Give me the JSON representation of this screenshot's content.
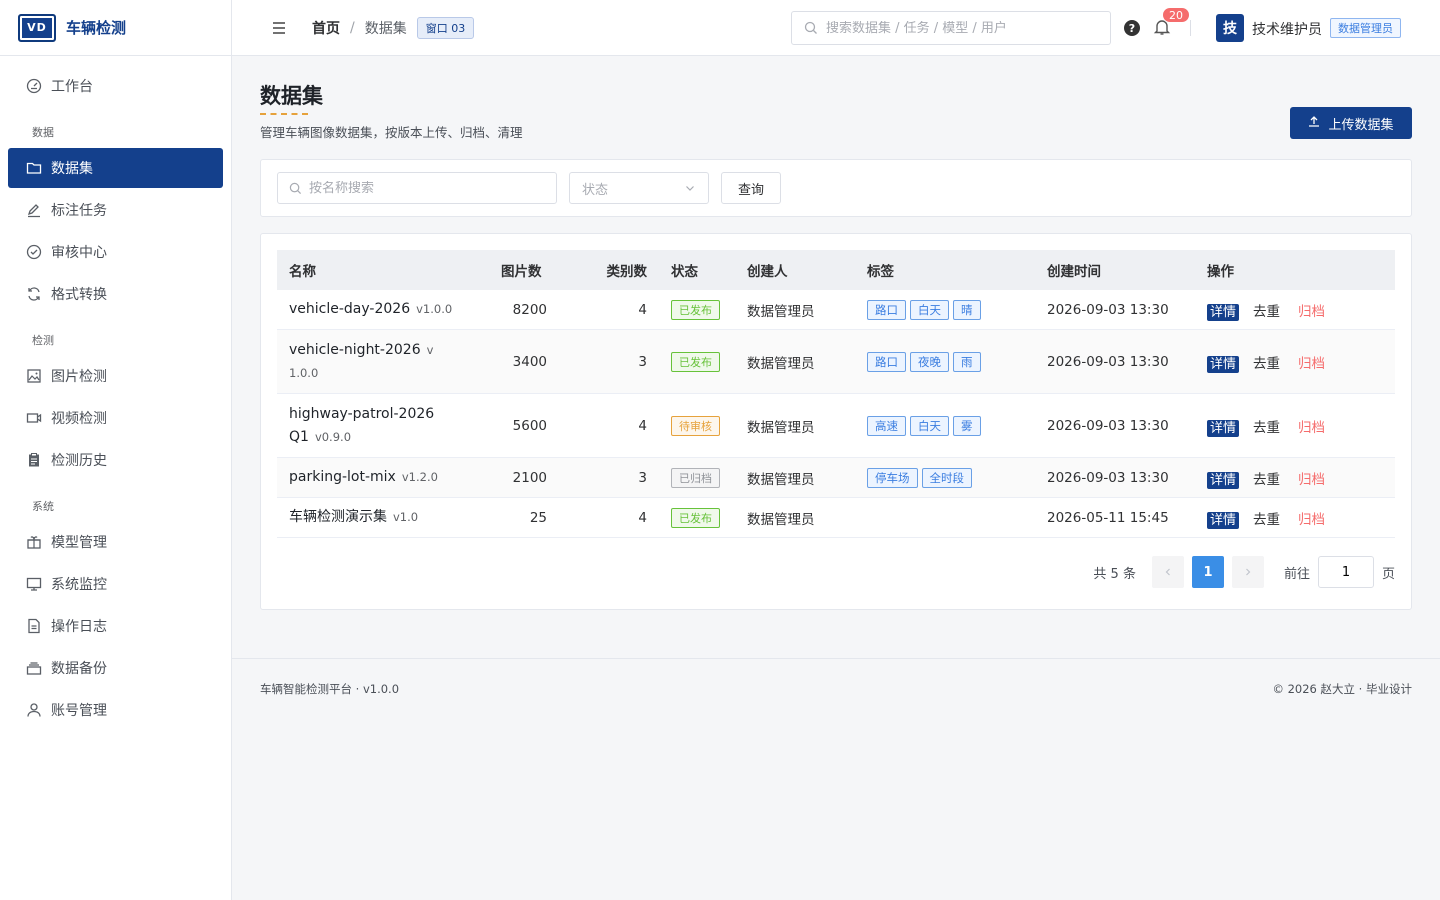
{
  "brand": {
    "logo": "VD",
    "name": "车辆检测"
  },
  "sidebar": {
    "items": [
      {
        "type": "item",
        "label": "工作台",
        "icon": "gauge-icon",
        "key": "workbench"
      },
      {
        "type": "group",
        "label": "数据"
      },
      {
        "type": "item",
        "label": "数据集",
        "icon": "folder-icon",
        "key": "datasets",
        "active": true
      },
      {
        "type": "item",
        "label": "标注任务",
        "icon": "edit-icon",
        "key": "annotation"
      },
      {
        "type": "item",
        "label": "审核中心",
        "icon": "check-circle-icon",
        "key": "review"
      },
      {
        "type": "item",
        "label": "格式转换",
        "icon": "refresh-icon",
        "key": "convert"
      },
      {
        "type": "group",
        "label": "检测"
      },
      {
        "type": "item",
        "label": "图片检测",
        "icon": "image-icon",
        "key": "image-detect"
      },
      {
        "type": "item",
        "label": "视频检测",
        "icon": "video-icon",
        "key": "video-detect"
      },
      {
        "type": "item",
        "label": "检测历史",
        "icon": "clipboard-icon",
        "key": "history"
      },
      {
        "type": "group",
        "label": "系统"
      },
      {
        "type": "item",
        "label": "模型管理",
        "icon": "gift-icon",
        "key": "models"
      },
      {
        "type": "item",
        "label": "系统监控",
        "icon": "monitor-icon",
        "key": "monitor"
      },
      {
        "type": "item",
        "label": "操作日志",
        "icon": "document-icon",
        "key": "logs"
      },
      {
        "type": "item",
        "label": "数据备份",
        "icon": "archive-icon",
        "key": "backup"
      },
      {
        "type": "item",
        "label": "账号管理",
        "icon": "user-icon",
        "key": "accounts"
      }
    ]
  },
  "header": {
    "breadcrumb_home": "首页",
    "breadcrumb_sep": "/",
    "breadcrumb_current": "数据集",
    "window_badge": "窗口 03",
    "search_placeholder": "搜索数据集 / 任务 / 模型 / 用户",
    "help_glyph": "?",
    "notification_count": "20",
    "avatar_text": "技",
    "username": "技术维护员",
    "role": "数据管理员"
  },
  "page": {
    "title": "数据集",
    "description": "管理车辆图像数据集，按版本上传、归档、清理",
    "upload_label": "上传数据集"
  },
  "filter": {
    "search_placeholder": "按名称搜索",
    "status_placeholder": "状态",
    "query_label": "查询"
  },
  "table": {
    "columns": {
      "name": "名称",
      "images": "图片数",
      "classes": "类别数",
      "status": "状态",
      "creator": "创建人",
      "tags": "标签",
      "created": "创建时间",
      "ops": "操作"
    },
    "ops": {
      "detail": "详情",
      "dedup": "去重",
      "archive": "归档"
    },
    "rows": [
      {
        "name": "vehicle-day-2026",
        "version": "v1.0.0",
        "images": "8200",
        "classes": "4",
        "status": "已发布",
        "status_kind": "pub",
        "creator": "数据管理员",
        "tags": [
          "路口",
          "白天",
          "晴"
        ],
        "created": "2026-09-03 13:30"
      },
      {
        "name": "vehicle-night-2026",
        "version": "v1.0.0",
        "images": "3400",
        "classes": "3",
        "status": "已发布",
        "status_kind": "pub",
        "creator": "数据管理员",
        "tags": [
          "路口",
          "夜晚",
          "雨"
        ],
        "created": "2026-09-03 13:30"
      },
      {
        "name": "highway-patrol-2026Q1",
        "version": "v0.9.0",
        "images": "5600",
        "classes": "4",
        "status": "待审核",
        "status_kind": "rev",
        "creator": "数据管理员",
        "tags": [
          "高速",
          "白天",
          "雾"
        ],
        "created": "2026-09-03 13:30"
      },
      {
        "name": "parking-lot-mix",
        "version": "v1.2.0",
        "images": "2100",
        "classes": "3",
        "status": "已归档",
        "status_kind": "arc",
        "creator": "数据管理员",
        "tags": [
          "停车场",
          "全时段"
        ],
        "created": "2026-09-03 13:30"
      },
      {
        "name": "车辆检测演示集",
        "version": "v1.0",
        "images": "25",
        "classes": "4",
        "status": "已发布",
        "status_kind": "pub",
        "creator": "数据管理员",
        "tags": [],
        "created": "2026-05-11 15:45"
      }
    ]
  },
  "pagination": {
    "total_label": "共 5 条",
    "current_page": "1",
    "goto_label": "前往",
    "goto_value": "1",
    "page_suffix": "页"
  },
  "footer": {
    "left": "车辆智能检测平台 · v1.0.0",
    "right": "© 2026 赵大立 · 毕业设计"
  },
  "colors": {
    "primary": "#14408c",
    "accent": "#3a8ee6",
    "danger": "#f56c6c",
    "success": "#67c23a",
    "warning": "#e6a23c"
  }
}
